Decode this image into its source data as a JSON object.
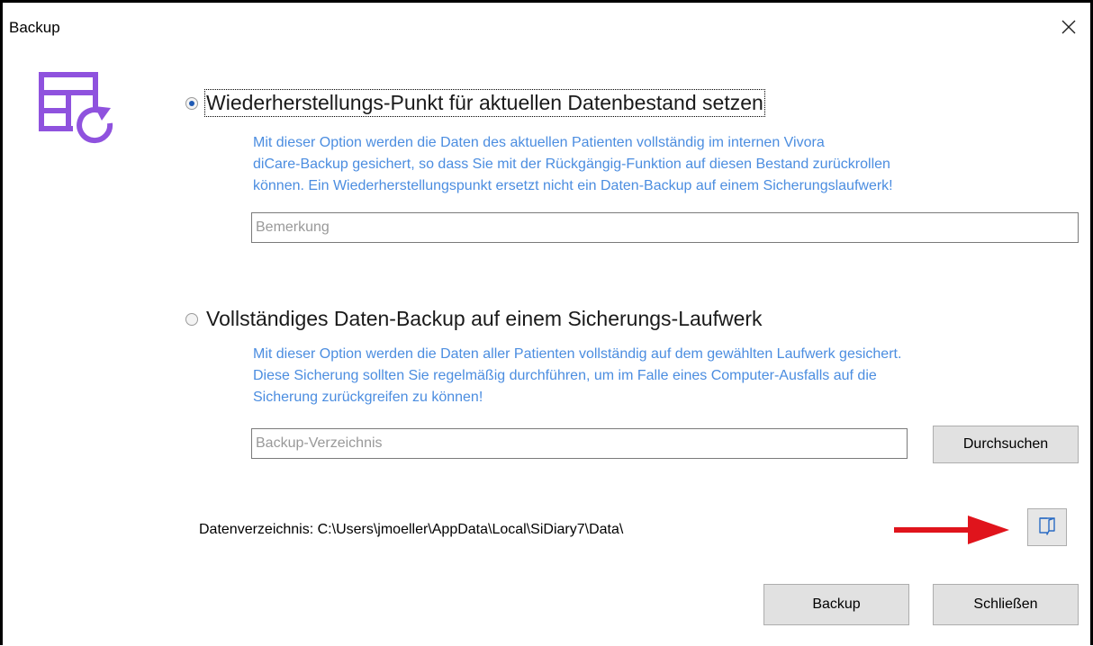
{
  "window": {
    "title": "Backup"
  },
  "icons": {
    "close": "close-icon",
    "logo": "database-restore-icon",
    "folder": "folder-icon",
    "arrow": "red-arrow-icon"
  },
  "colors": {
    "accent_text": "#4b8de0",
    "logo": "#8f52de",
    "arrow": "#e0141c"
  },
  "option_restore_point": {
    "label": "Wiederherstellungs-Punkt für aktuellen Datenbestand setzen",
    "selected": true,
    "description": [
      "Mit dieser Option werden die Daten des aktuellen Patienten vollständig im internen Vivora",
      "diCare-Backup gesichert, so dass Sie mit der Rückgängig-Funktion auf diesen Bestand zurückrollen",
      "können. Ein Wiederherstellungspunkt ersetzt nicht ein Daten-Backup auf einem Sicherungslaufwerk!"
    ],
    "remark_placeholder": "Bemerkung",
    "remark_value": ""
  },
  "option_full_backup": {
    "label": "Vollständiges Daten-Backup auf einem Sicherungs-Laufwerk",
    "selected": false,
    "description": [
      "Mit dieser Option werden die Daten aller Patienten vollständig auf dem gewählten Laufwerk gesichert.",
      "Diese Sicherung sollten Sie regelmäßig durchführen, um im Falle eines Computer-Ausfalls auf die",
      "Sicherung zurückgreifen zu können!"
    ],
    "directory_placeholder": "Backup-Verzeichnis",
    "directory_value": "",
    "browse_label": "Durchsuchen"
  },
  "data_directory": {
    "text": "Datenverzeichnis: C:\\Users\\jmoeller\\AppData\\Local\\SiDiary7\\Data\\"
  },
  "footer": {
    "backup_label": "Backup",
    "close_label": "Schließen"
  }
}
